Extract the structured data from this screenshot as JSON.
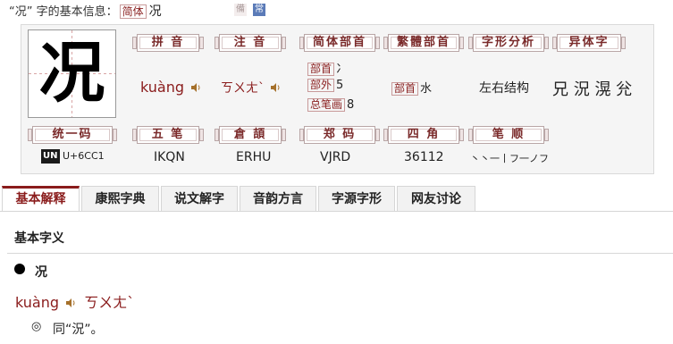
{
  "header": {
    "prefix_label": "“况” 字的基本信息：",
    "simplified_tag": "简体",
    "char": "况",
    "badge_common_light": "備",
    "badge_common": "常"
  },
  "char_display": "况",
  "cells_row1": {
    "pinyin": {
      "label": "拼 音",
      "value": "kuàng"
    },
    "zhuyin": {
      "label": "注 音",
      "value": "ㄎㄨㄤˋ"
    },
    "simp_radical": {
      "label": "简体部首",
      "radical_tag": "部首",
      "radical": "冫",
      "outer_tag": "部外",
      "outer": "5",
      "total_tag": "总笔画",
      "total": "8"
    },
    "trad_radical": {
      "label": "繁體部首",
      "tag": "部首",
      "value": "水"
    },
    "structure": {
      "label": "字形分析",
      "value": "左右结构"
    },
    "variants": {
      "label": "异体字",
      "value": "兄 況 滉 兊"
    }
  },
  "cells_row2": {
    "unicode": {
      "label": "统一码",
      "logo": "UN",
      "value": "U+6CC1"
    },
    "wubi": {
      "label": "五 笔",
      "value": "IKQN"
    },
    "cangjie": {
      "label": "倉 頡",
      "value": "ERHU"
    },
    "zhengma": {
      "label": "郑 码",
      "value": "VJRD"
    },
    "sijiao": {
      "label": "四 角",
      "value": "36112"
    },
    "bishun": {
      "label": "笔 顺",
      "value": "丶丶一丨フ一ノフ"
    }
  },
  "tabs": [
    "基本解释",
    "康熙字典",
    "说文解字",
    "音韵方言",
    "字源字形",
    "网友讨论"
  ],
  "active_tab": 0,
  "content": {
    "section_title": "基本字义",
    "entry_char": "况",
    "pinyin": "kuàng",
    "zhuyin": "ㄎㄨㄤˋ",
    "bullet": "◎",
    "definition": "同“況”。"
  },
  "colors": {
    "accent": "#8a1c1c",
    "plate_border": "#b9a6a6",
    "panel_bg": "#f5f5f5"
  }
}
